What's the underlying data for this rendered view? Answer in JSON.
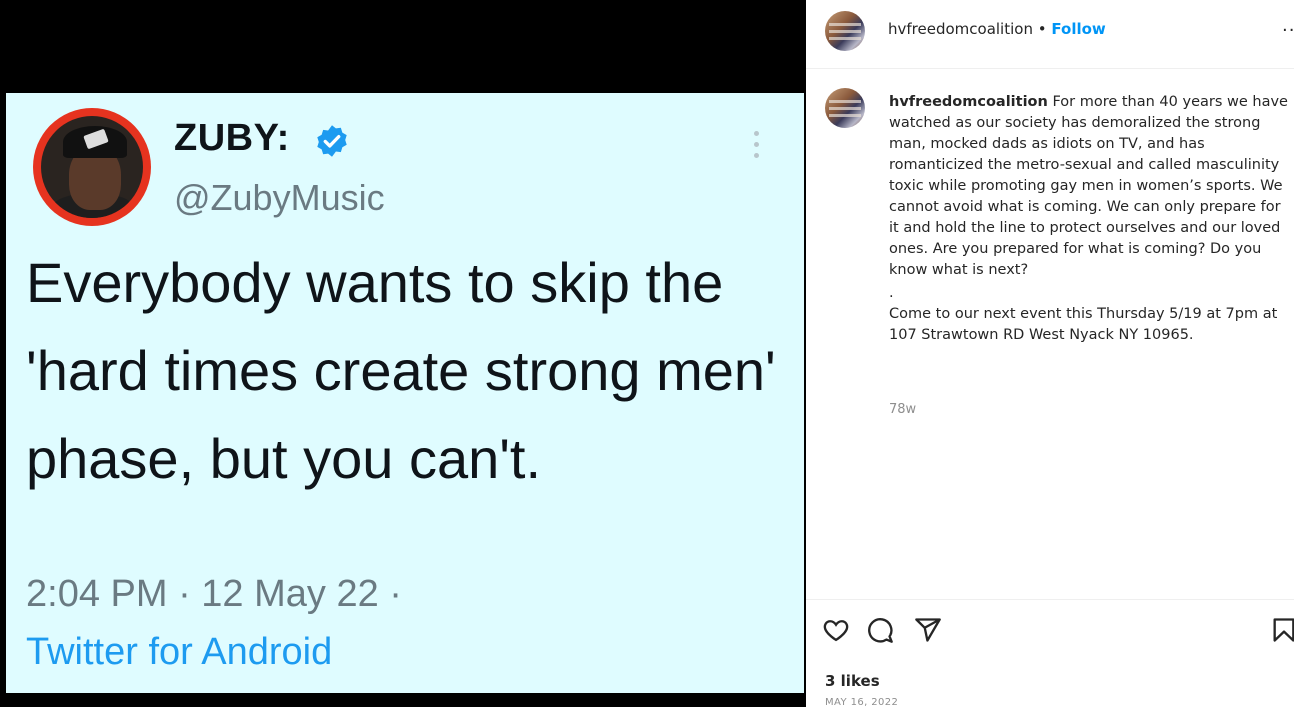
{
  "tweet": {
    "name": "ZUBY:",
    "handle": "@ZubyMusic",
    "text": "Everybody wants to skip the 'hard times create strong men' phase, but you can't.",
    "time": "2:04 PM · 12 May 22 ·",
    "source": "Twitter for Android"
  },
  "post": {
    "username": "hvfreedomcoalition",
    "separator": "•",
    "follow_label": "Follow",
    "more_label": "··",
    "caption_username": "hvfreedomcoalition",
    "caption_main": "For more than 40 years we have watched as our society has demoralized the strong man, mocked dads as idiots on TV, and has romanticized the metro-sexual and called masculinity toxic while promoting gay men in women’s sports. We cannot avoid what is coming. We can only prepare for it and hold the line to protect ourselves and our loved ones. Are you prepared for what is coming? Do you know what is next?",
    "caption_dot": ".",
    "caption_event": "Come to our next event this Thursday 5/19 at 7pm at 107 Strawtown RD West Nyack NY 10965.",
    "caption_age": "78w",
    "likes": "3 likes",
    "date": "MAY 16, 2022"
  },
  "icons": [
    "heart-icon",
    "comment-icon",
    "share-icon",
    "bookmark-icon",
    "verified-icon",
    "more-icon"
  ],
  "colors": {
    "tweet_bg": "#dffcff",
    "link": "#1d9bf0",
    "follow": "#0095f6"
  }
}
